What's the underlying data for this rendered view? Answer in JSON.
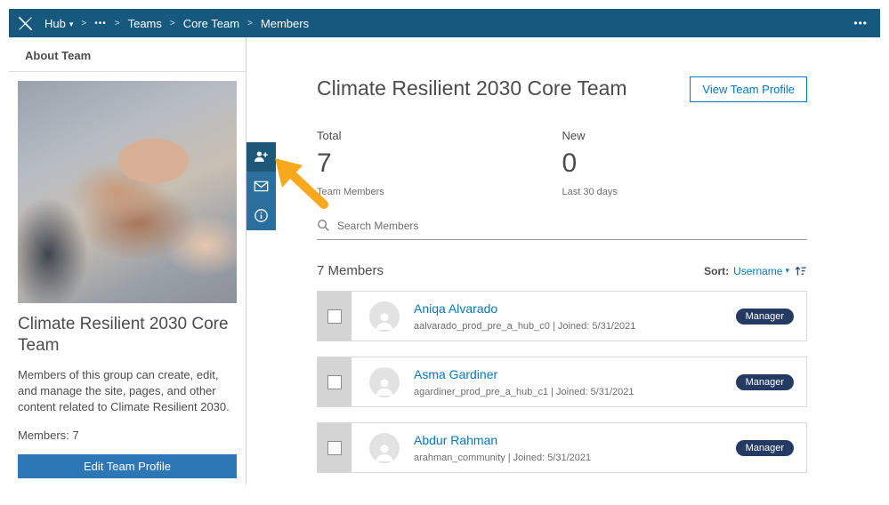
{
  "colors": {
    "nav_background": "#17597e",
    "accent_blue": "#0079c1",
    "rail_blue": "#2c6f9c",
    "rail_blue_active": "#1d5878",
    "edit_button_blue": "#2e77b6",
    "badge_navy": "#253a63",
    "annotation_arrow_yellow": "#f7a81c"
  },
  "icons": {
    "logo": "x-logo",
    "breadcrumb_caret": "chevron-down",
    "rail": [
      "add-member-icon",
      "envelope-icon",
      "info-circle-icon"
    ],
    "search": "search-icon",
    "sort": "sort-ascending-icon",
    "annotation": "yellow-arrow",
    "avatar": "person-silhouette"
  },
  "nav": {
    "app_label": "Hub",
    "caret": "▾",
    "separator": ">",
    "ellipsis": "•••",
    "breadcrumbs": [
      "Teams",
      "Core Team",
      "Members"
    ],
    "overflow_menu": "•••"
  },
  "sidebar": {
    "section_title": "About Team",
    "team_title": "Climate Resilient 2030 Core Team",
    "description": "Members of this group can create, edit, and manage the site, pages, and other content related to Climate Resilient 2030.",
    "members_count_label": "Members: 7",
    "edit_button_label": "Edit Team Profile"
  },
  "main": {
    "title": "Climate Resilient 2030 Core Team",
    "view_profile_button": "View Team Profile",
    "stats": [
      {
        "label": "Total",
        "value": "7",
        "sublabel": "Team Members"
      },
      {
        "label": "New",
        "value": "0",
        "sublabel": "Last 30 days"
      }
    ],
    "search_placeholder": "Search Members",
    "members_count": "7 Members",
    "sort_label": "Sort:",
    "sort_value": "Username",
    "sort_caret": "▾",
    "members": [
      {
        "name": "Aniqa Alvarado",
        "meta": "aalvarado_prod_pre_a_hub_c0 | Joined: 5/31/2021",
        "badge": "Manager"
      },
      {
        "name": "Asma Gardiner",
        "meta": "agardiner_prod_pre_a_hub_c1 | Joined: 5/31/2021",
        "badge": "Manager"
      },
      {
        "name": "Abdur Rahman",
        "meta": "arahman_community | Joined: 5/31/2021",
        "badge": "Manager"
      }
    ]
  }
}
